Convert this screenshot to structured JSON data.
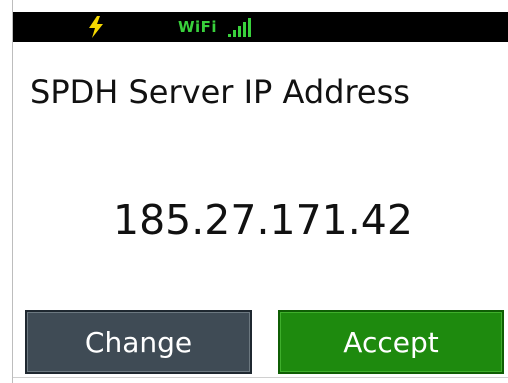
{
  "status_bar": {
    "wifi_label": "WiFi",
    "bolt_color": "#f5d800",
    "wifi_color": "#39d13c"
  },
  "screen": {
    "title": "SPDH Server IP Address",
    "ip_address": "185.27.171.42"
  },
  "buttons": {
    "change_label": "Change",
    "accept_label": "Accept"
  },
  "colors": {
    "change_button": "#3f4b55",
    "accept_button": "#1e8a0e"
  }
}
